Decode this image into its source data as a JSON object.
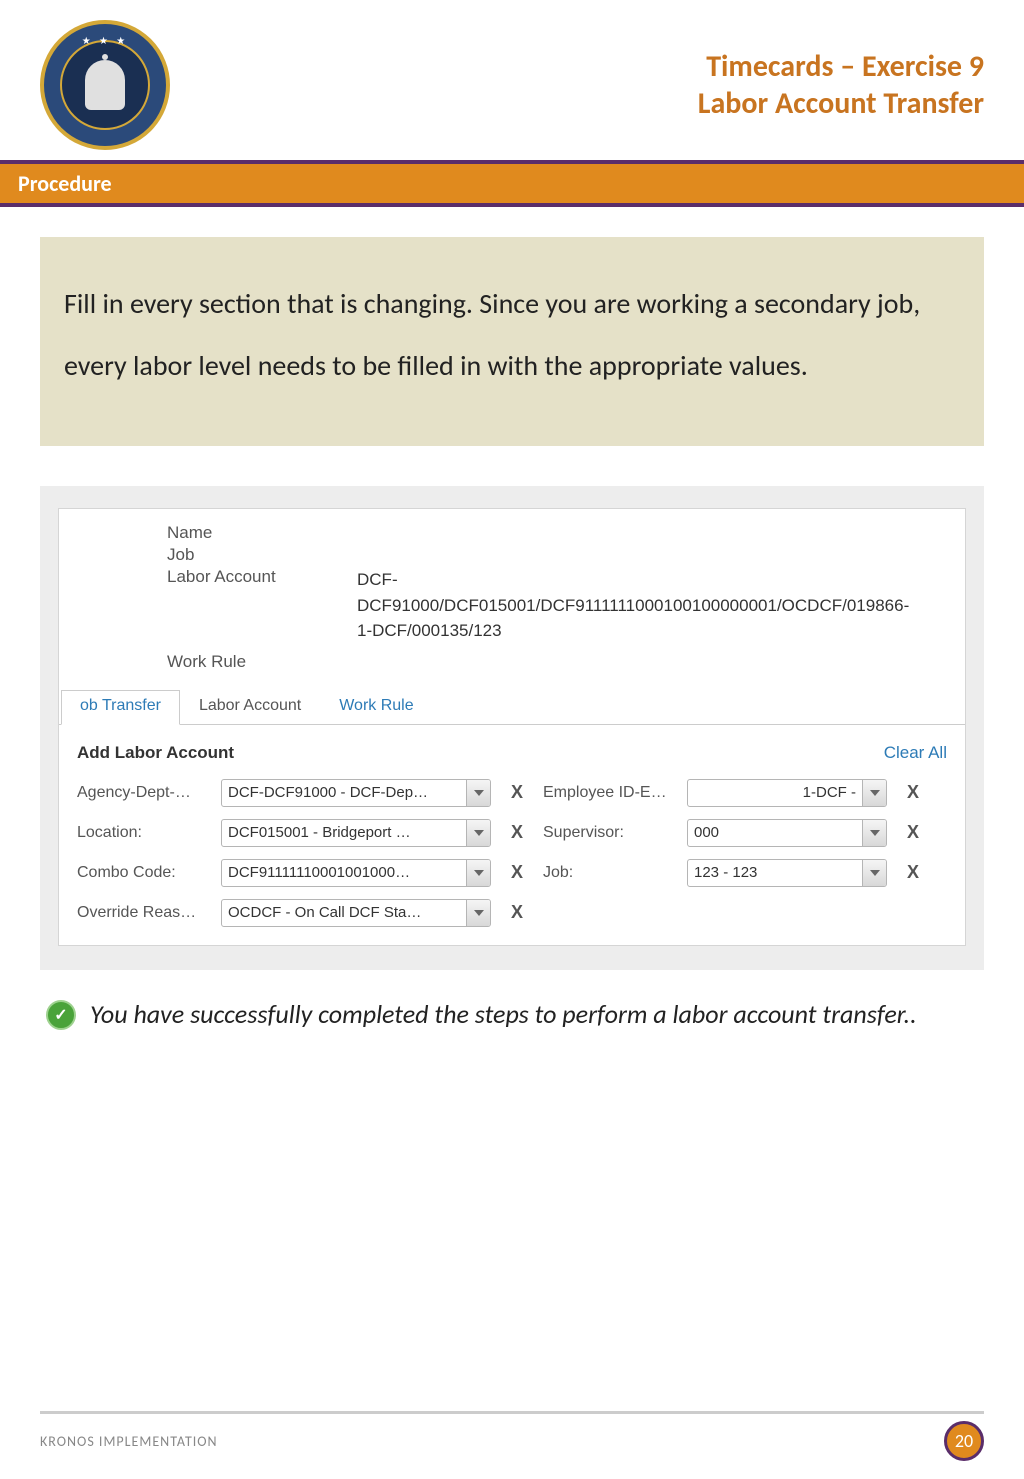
{
  "header": {
    "title_line1": "Timecards – Exercise 9",
    "title_line2": "Labor Account Transfer"
  },
  "sections": {
    "procedure_label": "Procedure"
  },
  "instruction": "Fill in every section that is changing. Since you are working a secondary job, every labor level needs to be filled in with the appropriate values.",
  "info": {
    "name_label": "Name",
    "job_label": "Job",
    "labor_account_label": "Labor Account",
    "labor_account_value": "DCF-DCF91000/DCF015001/DCF9111111000100100000001/OCDCF/019866-1-DCF/000135/123",
    "work_rule_label": "Work Rule"
  },
  "tabs": {
    "tab1": "ob Transfer",
    "tab2": "Labor Account",
    "tab3": "Work Rule"
  },
  "section_head": {
    "title": "Add Labor Account",
    "clear_all": "Clear All"
  },
  "form": {
    "agency_label": "Agency-Dept-…",
    "agency_value": "DCF-DCF91000 - DCF-Dep…",
    "employee_label": "Employee ID-E…",
    "employee_value": "1-DCF -",
    "location_label": "Location:",
    "location_value": "DCF015001 - Bridgeport …",
    "supervisor_label": "Supervisor:",
    "supervisor_value": "000",
    "combo_label": "Combo Code:",
    "combo_value": "DCF91111110001001000…",
    "job_label": "Job:",
    "job_value": "123 - 123",
    "override_label": "Override Reas…",
    "override_value": "OCDCF - On Call DCF Sta…"
  },
  "success": "You have successfully completed the steps to perform a labor account transfer..",
  "footer": {
    "label": "KRONOS IMPLEMENTATION",
    "page": "20"
  },
  "glyphs": {
    "x": "X",
    "check": "✓"
  }
}
